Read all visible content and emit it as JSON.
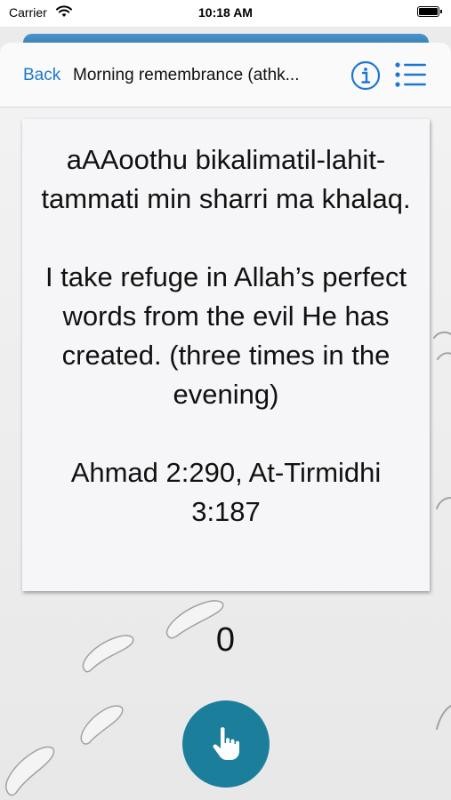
{
  "status_bar": {
    "carrier": "Carrier",
    "time": "10:18 AM",
    "battery_level": 1.0
  },
  "nav": {
    "back_label": "Back",
    "title": "Morning remembrance (athk...",
    "info_icon": "info-circle-icon",
    "list_icon": "list-icon"
  },
  "card": {
    "transliteration": "aAAoothu bikalimatil-lahit-tammati min sharri ma khalaq.",
    "translation": "I take refuge in Allah’s perfect words from the evil He has created. (three times in the evening)",
    "reference": "Ahmad 2:290, At-Tirmidhi 3:187"
  },
  "counter": {
    "value": "0"
  },
  "tap_button": {
    "icon": "hand-pointer-icon"
  },
  "colors": {
    "accent": "#1d77d2",
    "tap_button": "#1b7f9c",
    "header_strip": "#3a86bb"
  }
}
